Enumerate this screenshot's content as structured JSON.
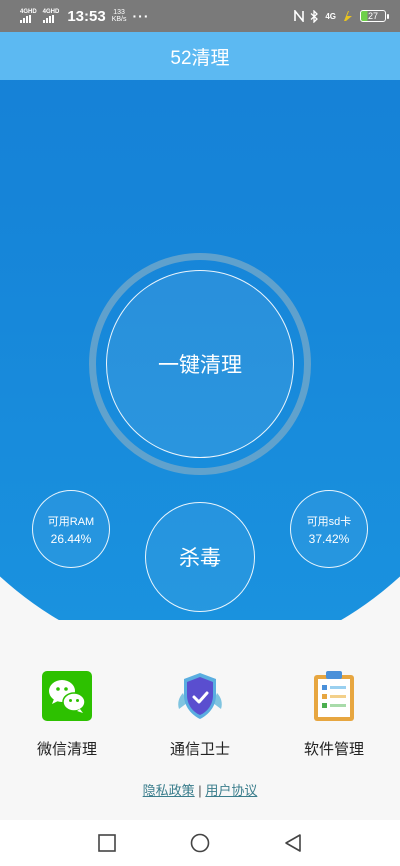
{
  "status_bar": {
    "network1": "4GHD",
    "network2": "4GHD",
    "time": "13:53",
    "speed_value": "133",
    "speed_unit": "KB/s",
    "more": "···",
    "signal_right": "4G",
    "battery": "27"
  },
  "header": {
    "title": "52清理"
  },
  "hero": {
    "clean_button": "一键清理",
    "antivirus_button": "杀毒",
    "ram": {
      "label": "可用RAM",
      "value": "26.44%"
    },
    "sd": {
      "label": "可用sd卡",
      "value": "37.42%"
    }
  },
  "features": [
    {
      "label": "微信清理",
      "icon": "wechat-icon"
    },
    {
      "label": "通信卫士",
      "icon": "shield-icon"
    },
    {
      "label": "软件管理",
      "icon": "clipboard-icon"
    }
  ],
  "links": {
    "privacy": "隐私政策",
    "separator": "|",
    "agreement": "用户协议"
  },
  "colors": {
    "hero_blue": "#1477cf",
    "header_blue": "#5cb9f2",
    "link": "#3a7d8c"
  }
}
